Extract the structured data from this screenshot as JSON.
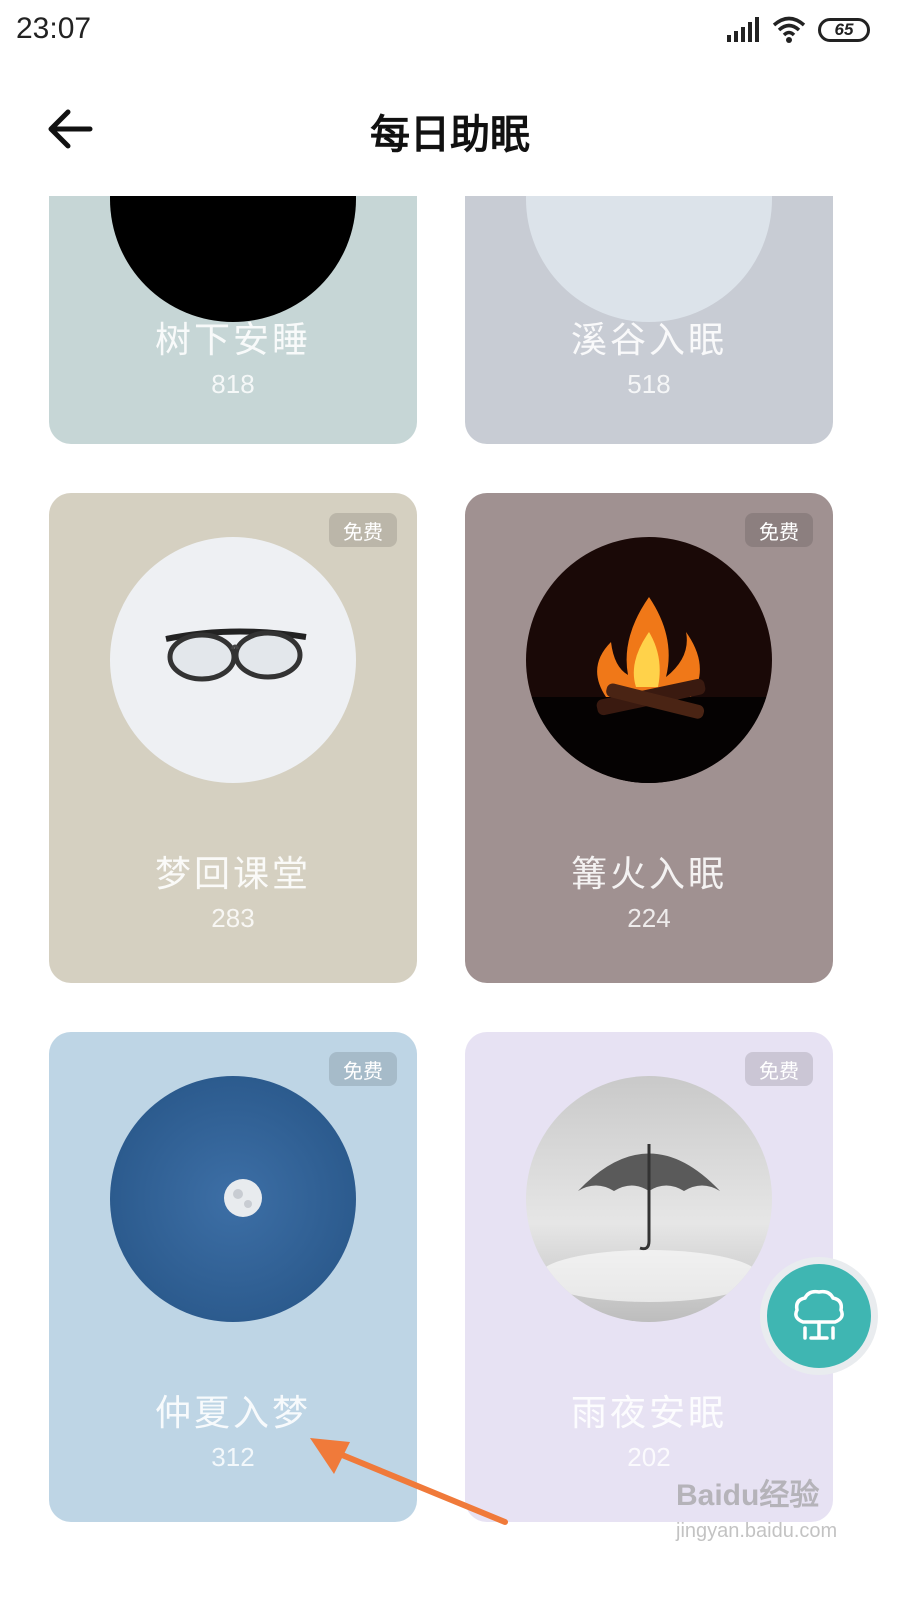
{
  "status_bar": {
    "time": "23:07",
    "battery": "65"
  },
  "header": {
    "title": "每日助眠"
  },
  "cards": [
    {
      "name": "树下安睡",
      "count": "818",
      "bg": "#c6d6d6",
      "art": "black-circle"
    },
    {
      "name": "溪谷入眠",
      "count": "518",
      "bg": "#c8ccd4",
      "art": "pale-blue-circle"
    },
    {
      "name": "梦回课堂",
      "count": "283",
      "badge": "免费",
      "bg": "#d5d0c1",
      "art": "glasses-image"
    },
    {
      "name": "篝火入眠",
      "count": "224",
      "badge": "免费",
      "bg": "#a09191",
      "art": "campfire-image"
    },
    {
      "name": "仲夏入梦",
      "count": "312",
      "badge": "免费",
      "bg": "#bed5e5",
      "art": "moon-image"
    },
    {
      "name": "雨夜安眠",
      "count": "202",
      "badge": "免费",
      "bg": "#e7e2f3",
      "art": "umbrella-rain-image"
    }
  ],
  "fab": {
    "icon": "tree-icon",
    "color": "#3fb6b2"
  },
  "watermark": {
    "logo": "Baidu经验",
    "url": "jingyan.baidu.com"
  },
  "annotation": {
    "icon": "orange-arrow",
    "color": "#f07a3a"
  }
}
